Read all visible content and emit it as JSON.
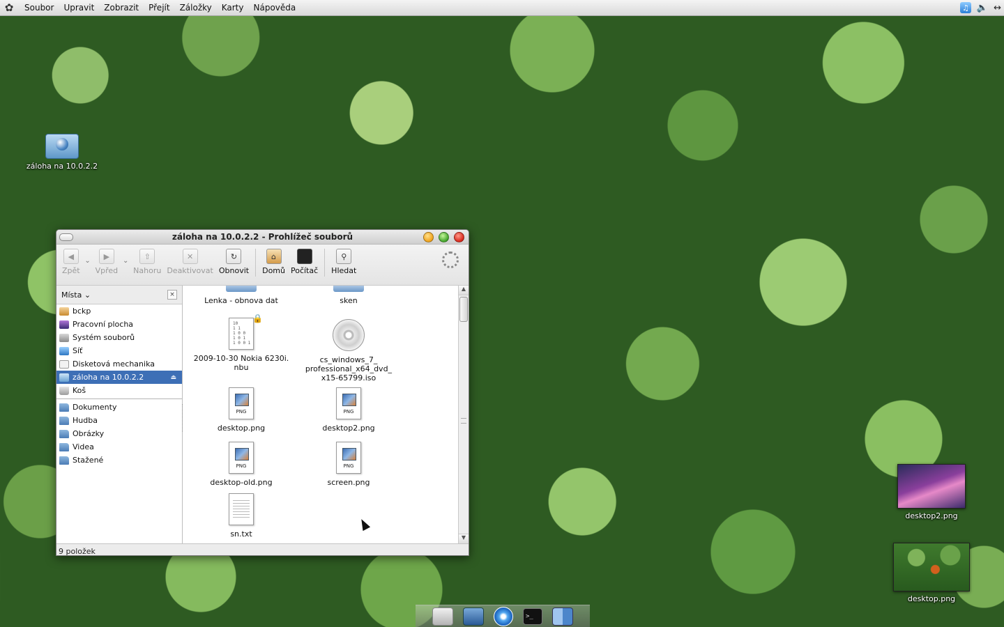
{
  "top_panel": {
    "menu": [
      "Soubor",
      "Upravit",
      "Zobrazit",
      "Přejít",
      "Záložky",
      "Karty",
      "Nápověda"
    ],
    "tray_icons": [
      "itunes-icon",
      "speaker-icon",
      "network-arrows-icon"
    ]
  },
  "desktop": {
    "icons": [
      {
        "label": "záloha na 10.0.2.2",
        "icon": "network-drive-icon"
      },
      {
        "label": "desktop2.png",
        "icon": "image-thumbnail"
      },
      {
        "label": "desktop.png",
        "icon": "image-thumbnail"
      }
    ]
  },
  "window": {
    "title": "záloha na 10.0.2.2 - Prohlížeč souborů",
    "toolbar": {
      "back": "Zpět",
      "forward": "Vpřed",
      "up": "Nahoru",
      "stop": "Deaktivovat",
      "reload": "Obnovit",
      "home": "Domů",
      "computer": "Počítač",
      "search": "Hledat"
    },
    "sidebar": {
      "header": "Místa",
      "places": [
        {
          "label": "bckp",
          "icon": "home-icon"
        },
        {
          "label": "Pracovní plocha",
          "icon": "desktop-icon"
        },
        {
          "label": "Systém souborů",
          "icon": "filesystem-icon"
        },
        {
          "label": "Síť",
          "icon": "network-icon"
        },
        {
          "label": "Disketová mechanika",
          "icon": "floppy-icon"
        },
        {
          "label": "záloha na 10.0.2.2",
          "icon": "network-share-icon",
          "selected": true
        },
        {
          "label": "Koš",
          "icon": "trash-icon"
        }
      ],
      "bookmarks": [
        {
          "label": "Dokumenty",
          "icon": "folder-icon"
        },
        {
          "label": "Hudba",
          "icon": "folder-icon"
        },
        {
          "label": "Obrázky",
          "icon": "folder-icon"
        },
        {
          "label": "Videa",
          "icon": "folder-icon"
        },
        {
          "label": "Stažené",
          "icon": "folder-icon"
        }
      ]
    },
    "files": [
      {
        "name": "Lenka - obnova dat",
        "type": "folder"
      },
      {
        "name": "sken",
        "type": "folder"
      },
      {
        "name": "2009-10-30 Nokia 6230i.\nnbu",
        "type": "binary",
        "locked": true
      },
      {
        "name": "cs_windows_7_\nprofessional_x64_dvd_\nx15-65799.iso",
        "type": "disc-image"
      },
      {
        "name": "desktop.png",
        "type": "png"
      },
      {
        "name": "desktop2.png",
        "type": "png"
      },
      {
        "name": "desktop-old.png",
        "type": "png"
      },
      {
        "name": "screen.png",
        "type": "png"
      },
      {
        "name": "sn.txt",
        "type": "text"
      }
    ],
    "png_tag": "PNG",
    "status": "9 položek"
  },
  "dock": {
    "items": [
      "folder-icon",
      "system-preferences-icon",
      "itunes-icon",
      "terminal-icon",
      "finder-icon"
    ]
  }
}
